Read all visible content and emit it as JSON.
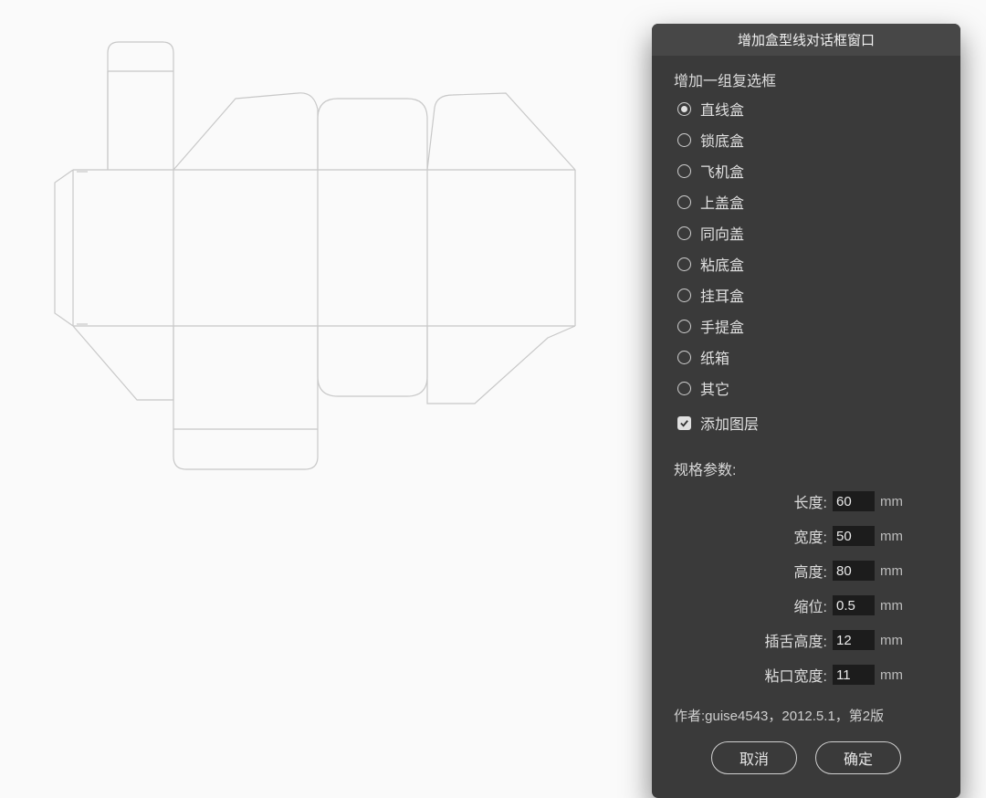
{
  "dialog": {
    "title": "增加盒型线对话框窗口",
    "group_label": "增加一组复选框",
    "radios": [
      {
        "label": "直线盒",
        "selected": true
      },
      {
        "label": "锁底盒",
        "selected": false
      },
      {
        "label": "飞机盒",
        "selected": false
      },
      {
        "label": "上盖盒",
        "selected": false
      },
      {
        "label": "同向盖",
        "selected": false
      },
      {
        "label": "粘底盒",
        "selected": false
      },
      {
        "label": "挂耳盒",
        "selected": false
      },
      {
        "label": "手提盒",
        "selected": false
      },
      {
        "label": "纸箱",
        "selected": false
      },
      {
        "label": "其它",
        "selected": false
      }
    ],
    "checkbox": {
      "label": "添加图层",
      "checked": true
    },
    "params_label": "规格参数:",
    "params": [
      {
        "label": "长度:",
        "value": "60",
        "unit": "mm"
      },
      {
        "label": "宽度:",
        "value": "50",
        "unit": "mm"
      },
      {
        "label": "高度:",
        "value": "80",
        "unit": "mm"
      },
      {
        "label": "缩位:",
        "value": "0.5",
        "unit": "mm"
      },
      {
        "label": "插舌高度:",
        "value": "12",
        "unit": "mm"
      },
      {
        "label": "粘口宽度:",
        "value": "11",
        "unit": "mm"
      }
    ],
    "footer": "作者:guise4543，2012.5.1，第2版",
    "cancel": "取消",
    "ok": "确定"
  }
}
